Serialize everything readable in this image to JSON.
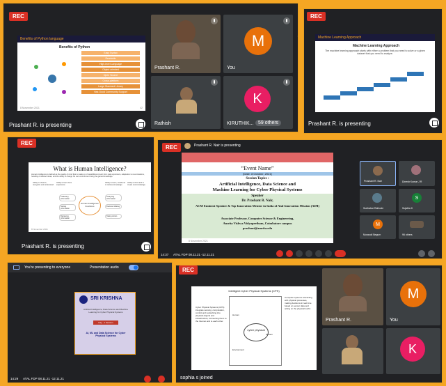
{
  "recording_badge": "REC",
  "panel1": {
    "slide_header": "Benefits of Python language",
    "slide_subtitle": "Benefits of Python",
    "slide_items": [
      "Easy Syntax",
      "Readable",
      "High-level Language",
      "Object oriented",
      "Open Source",
      "Cross-platform",
      "Large Standard Library",
      "Has Good Community Support"
    ],
    "slide_icon_labels": [
      "Flexible",
      "Portable",
      "Scalable",
      "Extensible",
      "Library"
    ],
    "slide_date": "8 November 2021",
    "slide_page": "42",
    "presenting_text": "Prashant R. is presenting",
    "tiles": [
      {
        "name": "Prashant R."
      },
      {
        "name": "You",
        "initial": "M"
      },
      {
        "name": "Rathish"
      },
      {
        "name": "KIRUTHIK...",
        "initial": "K",
        "others": "59 others"
      }
    ]
  },
  "panel2": {
    "slide_header": "Machine Learning Approach",
    "slide_subtitle": "Machine Learning Approach",
    "slide_text": "The machine learning approach starts with either a problem that you need to solve or a given dataset that you need to analyze.",
    "presenting_text": "Prashant R. is presenting"
  },
  "panel3": {
    "slide_title": "What is Human Intelligence?",
    "slide_text": "Human intelligence is defined as the quality of mind that is made up of capabilities to learn from past experience, adaptation to new situations, handling of abstract ideas, and the ability to change his own environment using the gained knowledge.",
    "left_labels": [
      "Ability to observe, recognize and understand",
      "Ability to learn from experience",
      "Ability to learn, recall and to retrieve knowledge",
      "Ability to think and to create new knowledge"
    ],
    "center_label": "Human Intelligence Functions",
    "nodes": [
      "Collecting Information",
      "Storing Information",
      "Retrieving Information",
      "Analyzing Information",
      "Decision Making",
      "Taking Action"
    ],
    "slide_date": "8 November 2021",
    "presenting_text": "Prashant R. is presenting"
  },
  "panel4": {
    "top_text": "Prashant R. Nair is presenting",
    "slide_title": "“Event Name”",
    "slide_date_line": "[Date: 8 October, 2021]",
    "session_topics": "Session Topics :",
    "topic1": "Artificial Intelligence, Data Science and",
    "topic2": "Machine Learning for Cyber Physical Systems",
    "speaker_label": "Speaker",
    "speaker_name": "Dr. Prashant R. Nair,",
    "speaker_title": "ACM Eminent Speaker & Top Innovation Mentor in India of Atal Innovation Mission (AIM)",
    "position": "Associate Professor, Computer Science & Engineering,",
    "university": "Amrita Vishwa Vidyapeetham, Coimbatore campus",
    "email": "prashant@amrita.edu",
    "slide_footer": "8 November 2021",
    "participants": [
      {
        "name": "Prashant R. Nair"
      },
      {
        "name": "Dinesh Kumar J R"
      },
      {
        "name": "Sudhakar Rathode"
      },
      {
        "name": "Sujatha K",
        "initial": "S"
      },
      {
        "name": "Murasoli Begum",
        "initial": "M"
      },
      {
        "name": "96 others"
      }
    ],
    "time": "14:37",
    "meeting_name": "ATAL FDP 08.11.21 -12.11.21"
  },
  "panel5": {
    "banner": "You're presenting to everyone",
    "audio_label": "Presentation audio",
    "college_name": "SRI KRISHNA",
    "slide_line1": "Artificial Intelligence, Data Science and Machine Learning for Cyber Physical Systems",
    "slide_line2": "Day - 1 Session",
    "slide_line3": "AI, ML and Data Science for Cyber Physical Systems",
    "time": "14:29",
    "meeting_name": "ATAL FDP 08.11.21 -12.11.21"
  },
  "panel6": {
    "slide_title": "Intelligent Cyber Physical Systems (CPS)",
    "left_text": "Cyber Physical Systems (CPS) integrate sensing, computation, control and networking into physical objects and infrastructure, connecting them to the Internet and to each other.",
    "diagram_center": "cyber physical",
    "diagram_labels": [
      "Human",
      "Environment",
      "System"
    ],
    "right_text": "Computer systems interacting with physical processes, making decisions in real time based on sensor data and acting on the physical world.",
    "tiles": [
      {
        "name": "Prashant R."
      },
      {
        "name": "You",
        "initial": "M"
      },
      {
        "name": ""
      },
      {
        "name": "",
        "initial": "K"
      }
    ],
    "joined_text": "sophia s joined"
  },
  "colors": {
    "frame_orange": "#f5a623",
    "meet_dark": "#202124",
    "tile_gray": "#3c4043",
    "rec_red": "#d93025",
    "avatar_orange": "#e8710a",
    "avatar_pink": "#e91e63",
    "avatar_green": "#188038"
  }
}
